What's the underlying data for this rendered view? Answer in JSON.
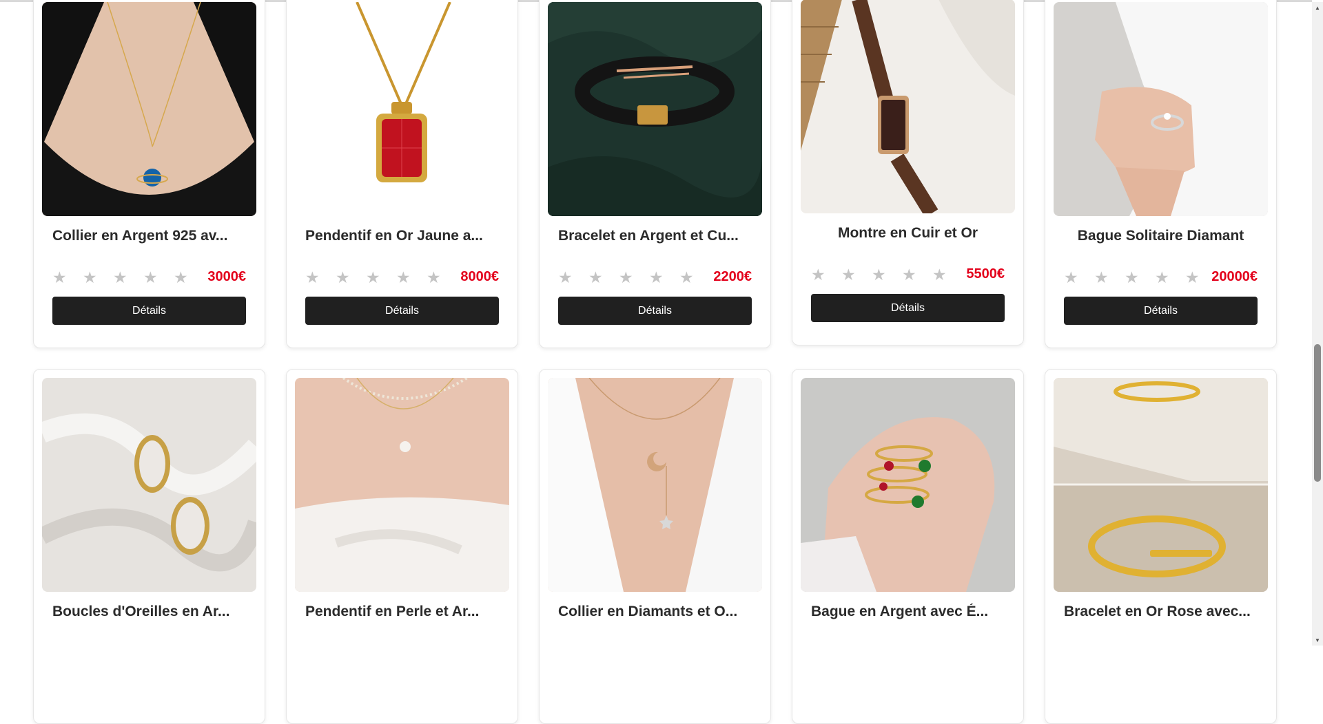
{
  "products": [
    {
      "name": "Collier en Argent 925 av...",
      "price": "3000€",
      "image": "necklace-blue-planet-pendant",
      "stars": 0
    },
    {
      "name": "Pendentif en Or Jaune a...",
      "price": "8000€",
      "image": "gold-red-gem-pendant",
      "stars": 0
    },
    {
      "name": "Bracelet en Argent et Cu...",
      "price": "2200€",
      "image": "leather-bracelet-green-feathers",
      "stars": 0
    },
    {
      "name": "Montre en Cuir et Or",
      "price": "5500€",
      "image": "brown-leather-watch",
      "stars": 0
    },
    {
      "name": "Bague Solitaire Diamant",
      "price": "20000€",
      "image": "diamond-ring-hand",
      "stars": 0
    },
    {
      "name": "Boucles d'Oreilles en Ar...",
      "price": "",
      "image": "pearl-earrings-silk",
      "stars": 0
    },
    {
      "name": "Pendentif en Perle et Ar...",
      "price": "",
      "image": "pearl-pendant-necklace",
      "stars": 0
    },
    {
      "name": "Collier en Diamants et O...",
      "price": "",
      "image": "moon-star-necklace",
      "stars": 0
    },
    {
      "name": "Bague en Argent avec É...",
      "price": "",
      "image": "gold-rings-emerald-ruby",
      "stars": 0
    },
    {
      "name": "Bracelet en Or Rose avec...",
      "price": "",
      "image": "gold-nail-bracelet-stone",
      "stars": 0
    }
  ],
  "button_label": "Détails",
  "star_glyph": "★",
  "colors": {
    "price": "#e3001b",
    "button": "#202020",
    "star_empty": "#c4c4c4"
  }
}
